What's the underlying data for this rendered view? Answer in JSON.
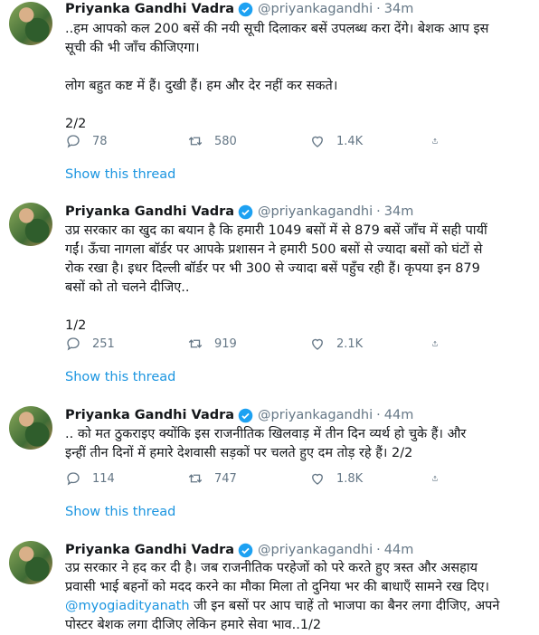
{
  "tweets": [
    {
      "name": "Priyanka Gandhi Vadra",
      "handle": "@priyankagandhi",
      "time": "34m",
      "lines": [
        "..हम आपको कल 200 बसें की नयी सूची दिलाकर बसें उपलब्ध करा देंगे। बेशक आप इस",
        "सूची की भी जाँच कीजिएगा।",
        "",
        "लोग बहुत कष्ट में हैं। दुखी हैं। हम और देर नहीं कर सकते।",
        "",
        "2/2"
      ],
      "reply_count": "78",
      "retweet_count": "580",
      "like_count": "1.4K",
      "show_thread": "Show this thread"
    },
    {
      "name": "Priyanka Gandhi Vadra",
      "handle": "@priyankagandhi",
      "time": "34m",
      "lines": [
        "उप्र सरकार का खुद का बयान है कि हमारी 1049 बसों में से 879 बसें जाँच में सही पायीं",
        "गईं। ऊँचा नागला बॉर्डर पर आपके प्रशासन ने हमारी 500 बसों से ज्यादा बसों को घंटों से",
        "रोक रखा है। इधर दिल्ली बॉर्डर पर भी 300 से ज्यादा बसें पहुँच रही हैं। कृपया इन 879",
        "बसों को तो चलने दीजिए..",
        "",
        "1/2"
      ],
      "reply_count": "251",
      "retweet_count": "919",
      "like_count": "2.1K",
      "show_thread": "Show this thread"
    },
    {
      "name": "Priyanka Gandhi Vadra",
      "handle": "@priyankagandhi",
      "time": "44m",
      "lines": [
        ".. को मत ठुकराइए क्योंकि इस राजनीतिक खिलवाड़ में तीन दिन व्यर्थ हो चुके हैं। और",
        "इन्हीं तीन दिनों में हमारे देशवासी सड़कों पर चलते हुए दम तोड़ रहे हैं। 2/2"
      ],
      "reply_count": "114",
      "retweet_count": "747",
      "like_count": "1.8K",
      "show_thread": "Show this thread"
    },
    {
      "name": "Priyanka Gandhi Vadra",
      "handle": "@priyankagandhi",
      "time": "44m",
      "lines": [
        "उप्र सरकार ने हद कर दी है। जब राजनीतिक परहेजों को परे करते हुए त्रस्त और असहाय",
        "प्रवासी भाई बहनों को मदद करने का मौका मिला तो दुनिया भर की बाधाएँ सामने रख दिए।"
      ],
      "mention": "@myogiadityanath",
      "mention_rest": " जी इन बसों  पर आप चाहें तो भाजपा का बैनर लगा दीजिए, अपने",
      "last_line": "पोस्टर बेशक लगा दीजिए लेकिन हमारे सेवा भाव..1/2"
    }
  ],
  "colors": {
    "link": "#1b95e0",
    "muted": "#657786",
    "divider": "#e6ecf0",
    "verified": "#1da1f2"
  },
  "icons": [
    "verified-badge-icon",
    "reply-icon",
    "retweet-icon",
    "like-icon",
    "share-icon"
  ]
}
